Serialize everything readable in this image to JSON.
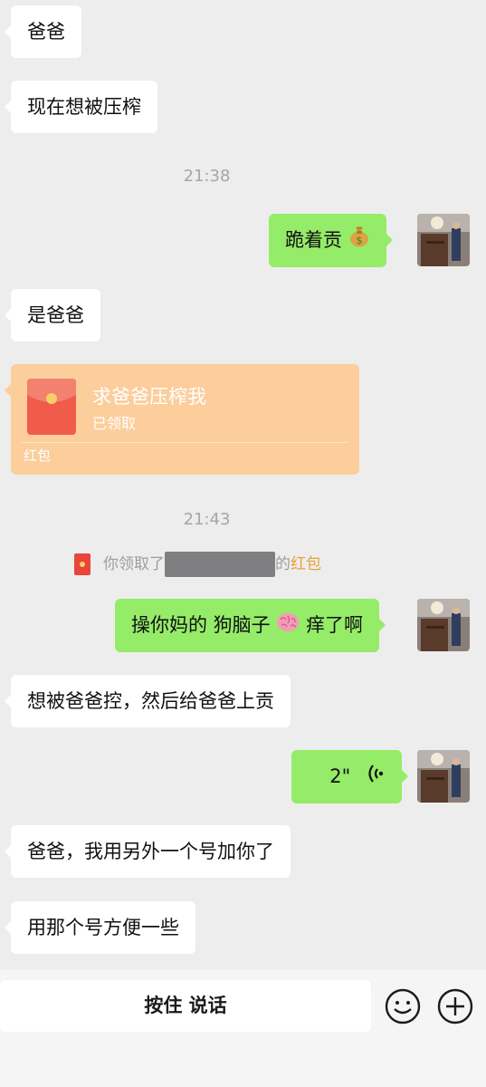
{
  "messages": {
    "m1": "爸爸",
    "m2": "现在想被压榨",
    "t1": "21:38",
    "m3": "跪着贡",
    "m4": "是爸爸",
    "packet": {
      "title": "求爸爸压榨我",
      "status": "已领取",
      "label": "红包"
    },
    "t2": "21:43",
    "system": {
      "prefix": "你领取了",
      "suffix": "的",
      "keyword": "红包"
    },
    "m5a": "操你妈的 狗脑子",
    "m5b": "痒了啊",
    "m6": "想被爸爸控，然后给爸爸上贡",
    "voice": "2\"",
    "m7": "爸爸，我用另外一个号加你了",
    "m8": "用那个号方便一些"
  },
  "input": {
    "talk_label": "按住 说话"
  },
  "icons": {
    "money_bag": "money-bag-icon",
    "brain": "brain-icon",
    "voice": "voice-wave-icon",
    "emoji": "emoji-face-icon",
    "plus": "plus-circle-icon"
  },
  "colors": {
    "incoming": "#ffffff",
    "outgoing": "#95ec69",
    "packet": "#fbce9c",
    "background": "#ededed"
  }
}
